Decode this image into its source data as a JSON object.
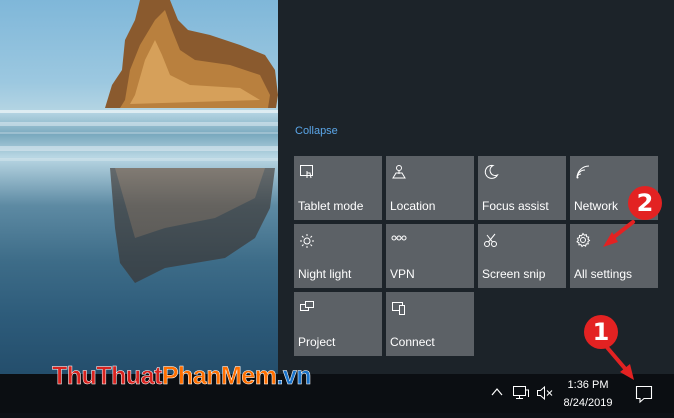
{
  "action_center": {
    "collapse_label": "Collapse",
    "tiles": [
      {
        "label": "Tablet mode",
        "icon": "tablet-mode-icon"
      },
      {
        "label": "Location",
        "icon": "location-icon"
      },
      {
        "label": "Focus assist",
        "icon": "moon-icon"
      },
      {
        "label": "Network",
        "icon": "network-icon"
      },
      {
        "label": "Night light",
        "icon": "brightness-icon"
      },
      {
        "label": "VPN",
        "icon": "vpn-icon"
      },
      {
        "label": "Screen snip",
        "icon": "screen-snip-icon"
      },
      {
        "label": "All settings",
        "icon": "gear-icon"
      },
      {
        "label": "Project",
        "icon": "project-icon"
      },
      {
        "label": "Connect",
        "icon": "connect-icon"
      }
    ]
  },
  "taskbar": {
    "time": "1:36 PM",
    "date": "8/24/2019",
    "tray_icons": [
      "chevron-up-icon",
      "network-wired-icon",
      "speaker-muted-icon"
    ],
    "notification_icon": "notification-icon"
  },
  "annotations": {
    "step1": "1",
    "step2": "2",
    "arrow_color": "#e32222"
  },
  "watermark": {
    "part1": "ThuThuat",
    "part2": "PhanMem",
    "part3": ".vn",
    "colors": [
      "#d8231f",
      "#ff6f00",
      "#1a73c9"
    ]
  }
}
